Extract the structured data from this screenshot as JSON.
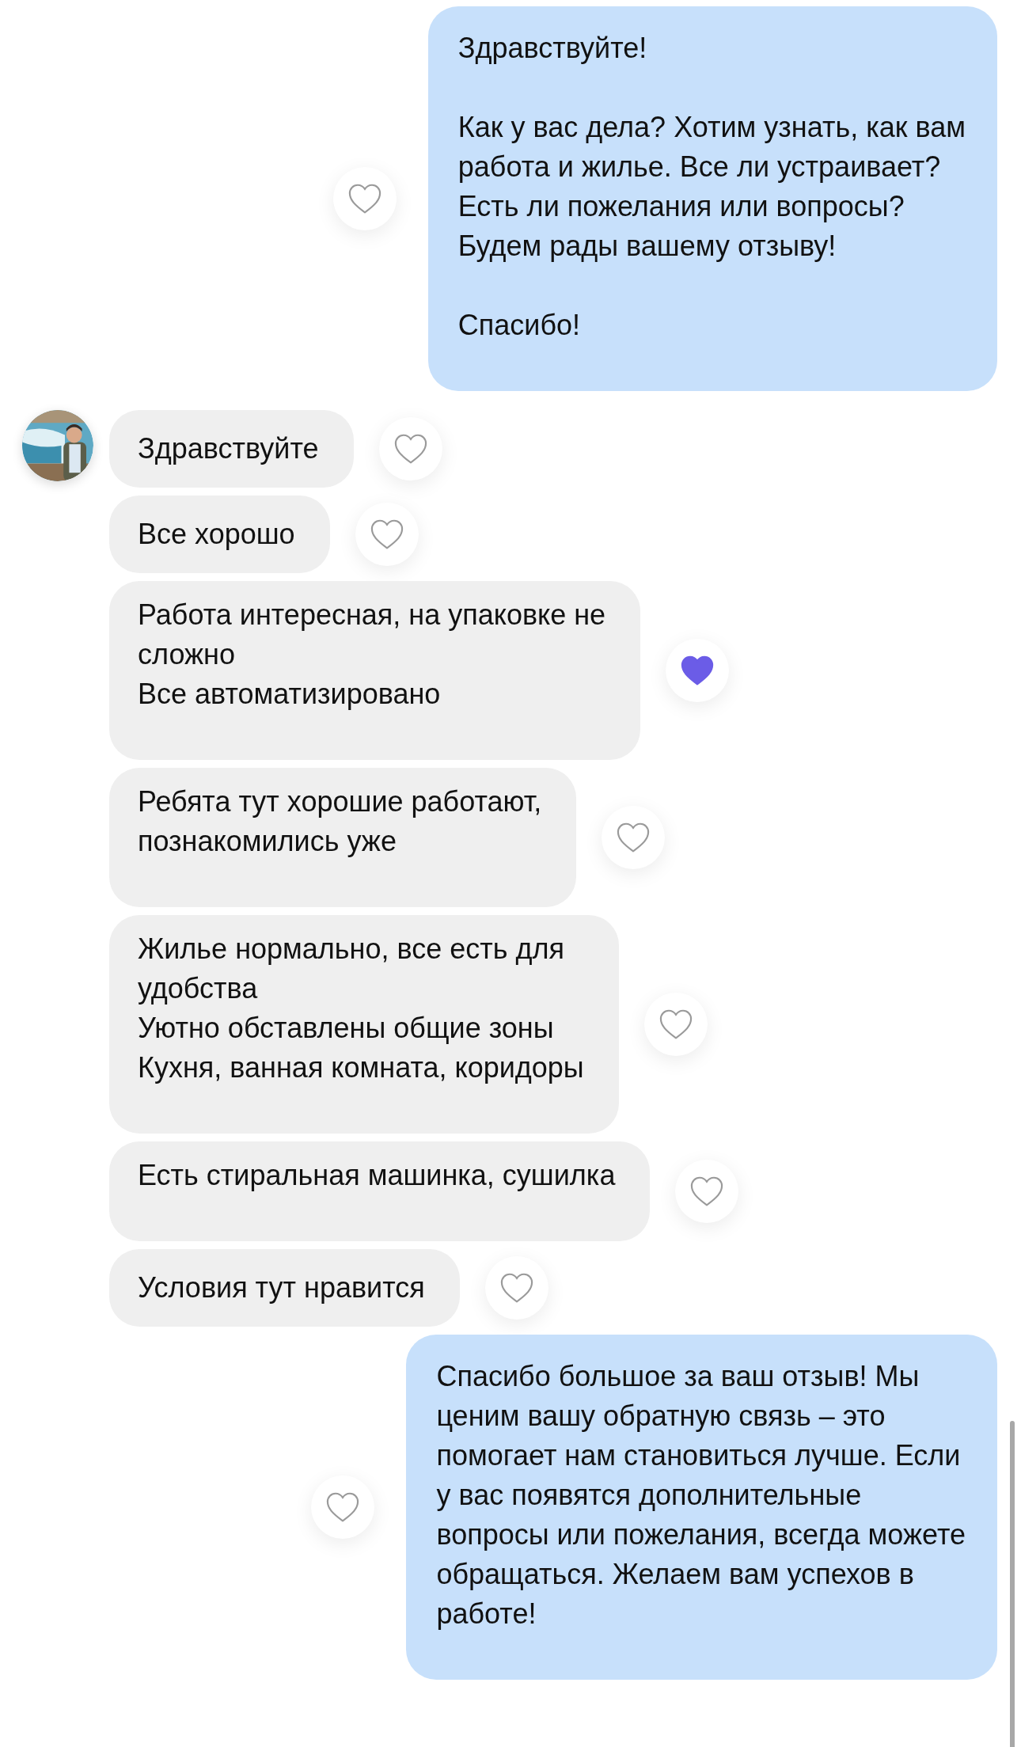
{
  "messages": [
    {
      "kind": "out",
      "text": "Здравствуйте!\n\nКак у вас дела? Хотим узнать, как вам\nработа и жилье. Все ли устраивает?\nЕсть ли пожелания или вопросы?\nБудем рады вашему отзыву!\n\nСпасибо!",
      "liked": false,
      "show_avatar": false
    },
    {
      "kind": "in",
      "text": "Здравствуйте",
      "liked": false,
      "show_avatar": true
    },
    {
      "kind": "in",
      "text": "Все хорошо",
      "liked": false,
      "show_avatar": false
    },
    {
      "kind": "in",
      "text": "Работа интересная, на упаковке не\nсложно\nВсе автоматизировано",
      "liked": true,
      "show_avatar": false
    },
    {
      "kind": "in",
      "text": "Ребята тут хорошие работают,\nпознакомились уже",
      "liked": false,
      "show_avatar": false
    },
    {
      "kind": "in",
      "text": "Жилье нормально, все есть для\nудобства\nУютно обставлены общие зоны\nКухня, ванная комната, коридоры",
      "liked": false,
      "show_avatar": false
    },
    {
      "kind": "in",
      "text": "Есть стиральная машинка, сушилка",
      "liked": false,
      "show_avatar": false
    },
    {
      "kind": "in",
      "text": "Условия тут нравится",
      "liked": false,
      "show_avatar": false
    },
    {
      "kind": "out",
      "text": "Спасибо большое за ваш отзыв! Мы\nценим вашу обратную связь – это\nпомогает нам становиться лучше. Если\nу вас появятся дополнительные\nвопросы или пожелания, всегда можете\nобращаться. Желаем вам успехов в\nработе!",
      "liked": false,
      "show_avatar": false
    }
  ]
}
